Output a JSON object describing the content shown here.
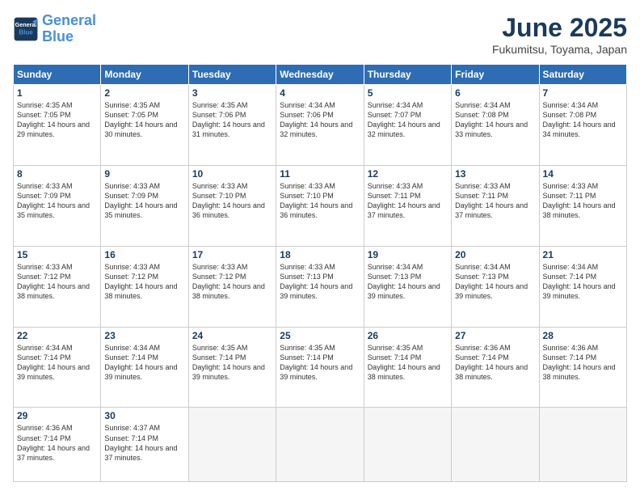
{
  "header": {
    "logo_line1": "General",
    "logo_line2": "Blue",
    "month_title": "June 2025",
    "subtitle": "Fukumitsu, Toyama, Japan"
  },
  "weekdays": [
    "Sunday",
    "Monday",
    "Tuesday",
    "Wednesday",
    "Thursday",
    "Friday",
    "Saturday"
  ],
  "weeks": [
    [
      {
        "day": "1",
        "sunrise": "4:35 AM",
        "sunset": "7:05 PM",
        "daylight": "14 hours and 29 minutes."
      },
      {
        "day": "2",
        "sunrise": "4:35 AM",
        "sunset": "7:05 PM",
        "daylight": "14 hours and 30 minutes."
      },
      {
        "day": "3",
        "sunrise": "4:35 AM",
        "sunset": "7:06 PM",
        "daylight": "14 hours and 31 minutes."
      },
      {
        "day": "4",
        "sunrise": "4:34 AM",
        "sunset": "7:06 PM",
        "daylight": "14 hours and 32 minutes."
      },
      {
        "day": "5",
        "sunrise": "4:34 AM",
        "sunset": "7:07 PM",
        "daylight": "14 hours and 32 minutes."
      },
      {
        "day": "6",
        "sunrise": "4:34 AM",
        "sunset": "7:08 PM",
        "daylight": "14 hours and 33 minutes."
      },
      {
        "day": "7",
        "sunrise": "4:34 AM",
        "sunset": "7:08 PM",
        "daylight": "14 hours and 34 minutes."
      }
    ],
    [
      {
        "day": "8",
        "sunrise": "4:33 AM",
        "sunset": "7:09 PM",
        "daylight": "14 hours and 35 minutes."
      },
      {
        "day": "9",
        "sunrise": "4:33 AM",
        "sunset": "7:09 PM",
        "daylight": "14 hours and 35 minutes."
      },
      {
        "day": "10",
        "sunrise": "4:33 AM",
        "sunset": "7:10 PM",
        "daylight": "14 hours and 36 minutes."
      },
      {
        "day": "11",
        "sunrise": "4:33 AM",
        "sunset": "7:10 PM",
        "daylight": "14 hours and 36 minutes."
      },
      {
        "day": "12",
        "sunrise": "4:33 AM",
        "sunset": "7:11 PM",
        "daylight": "14 hours and 37 minutes."
      },
      {
        "day": "13",
        "sunrise": "4:33 AM",
        "sunset": "7:11 PM",
        "daylight": "14 hours and 37 minutes."
      },
      {
        "day": "14",
        "sunrise": "4:33 AM",
        "sunset": "7:11 PM",
        "daylight": "14 hours and 38 minutes."
      }
    ],
    [
      {
        "day": "15",
        "sunrise": "4:33 AM",
        "sunset": "7:12 PM",
        "daylight": "14 hours and 38 minutes."
      },
      {
        "day": "16",
        "sunrise": "4:33 AM",
        "sunset": "7:12 PM",
        "daylight": "14 hours and 38 minutes."
      },
      {
        "day": "17",
        "sunrise": "4:33 AM",
        "sunset": "7:12 PM",
        "daylight": "14 hours and 38 minutes."
      },
      {
        "day": "18",
        "sunrise": "4:33 AM",
        "sunset": "7:13 PM",
        "daylight": "14 hours and 39 minutes."
      },
      {
        "day": "19",
        "sunrise": "4:34 AM",
        "sunset": "7:13 PM",
        "daylight": "14 hours and 39 minutes."
      },
      {
        "day": "20",
        "sunrise": "4:34 AM",
        "sunset": "7:13 PM",
        "daylight": "14 hours and 39 minutes."
      },
      {
        "day": "21",
        "sunrise": "4:34 AM",
        "sunset": "7:14 PM",
        "daylight": "14 hours and 39 minutes."
      }
    ],
    [
      {
        "day": "22",
        "sunrise": "4:34 AM",
        "sunset": "7:14 PM",
        "daylight": "14 hours and 39 minutes."
      },
      {
        "day": "23",
        "sunrise": "4:34 AM",
        "sunset": "7:14 PM",
        "daylight": "14 hours and 39 minutes."
      },
      {
        "day": "24",
        "sunrise": "4:35 AM",
        "sunset": "7:14 PM",
        "daylight": "14 hours and 39 minutes."
      },
      {
        "day": "25",
        "sunrise": "4:35 AM",
        "sunset": "7:14 PM",
        "daylight": "14 hours and 39 minutes."
      },
      {
        "day": "26",
        "sunrise": "4:35 AM",
        "sunset": "7:14 PM",
        "daylight": "14 hours and 38 minutes."
      },
      {
        "day": "27",
        "sunrise": "4:36 AM",
        "sunset": "7:14 PM",
        "daylight": "14 hours and 38 minutes."
      },
      {
        "day": "28",
        "sunrise": "4:36 AM",
        "sunset": "7:14 PM",
        "daylight": "14 hours and 38 minutes."
      }
    ],
    [
      {
        "day": "29",
        "sunrise": "4:36 AM",
        "sunset": "7:14 PM",
        "daylight": "14 hours and 37 minutes."
      },
      {
        "day": "30",
        "sunrise": "4:37 AM",
        "sunset": "7:14 PM",
        "daylight": "14 hours and 37 minutes."
      },
      null,
      null,
      null,
      null,
      null
    ]
  ]
}
